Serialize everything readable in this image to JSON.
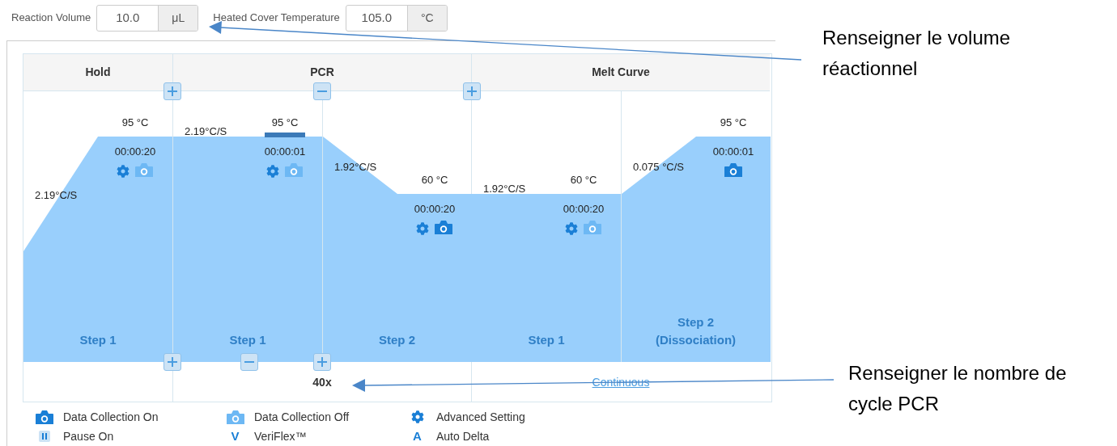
{
  "settings": [
    {
      "label": "Reaction Volume",
      "value": "10.0",
      "unit": "μL"
    },
    {
      "label": "Heated Cover Temperature",
      "value": "105.0",
      "unit": "°C"
    }
  ],
  "stages": [
    {
      "name": "Hold",
      "steps": [
        {
          "label": "Step 1",
          "temp": "95 °C",
          "time": "00:00:20",
          "rate": "2.19°C/S",
          "gear": true,
          "data_collection": false,
          "selected": false
        }
      ]
    },
    {
      "name": "PCR",
      "footer": {
        "kind": "cycles",
        "text": "40x"
      },
      "steps": [
        {
          "label": "Step 1",
          "temp": "95 °C",
          "time": "00:00:01",
          "rate": "2.19°C/S",
          "gear": true,
          "data_collection": false,
          "selected": true
        },
        {
          "label": "Step 2",
          "temp": "60 °C",
          "time": "00:00:20",
          "rate": "1.92°C/S",
          "gear": true,
          "data_collection": true,
          "selected": false
        }
      ]
    },
    {
      "name": "Melt Curve",
      "footer": {
        "kind": "link",
        "text": "Continuous"
      },
      "steps": [
        {
          "label": "Step 1",
          "temp": "60 °C",
          "time": "00:00:20",
          "rate": "1.92°C/S",
          "gear": true,
          "data_collection": false,
          "selected": false
        },
        {
          "label": "Step 2",
          "sublabel": "(Dissociation)",
          "temp": "95 °C",
          "time": "00:00:01",
          "rate": "0.075 °C/S",
          "gear": false,
          "data_collection": true,
          "selected": false
        }
      ]
    }
  ],
  "legend": [
    {
      "kind": "camera_on",
      "label": "Data Collection On"
    },
    {
      "kind": "camera_off",
      "label": "Data Collection Off"
    },
    {
      "kind": "gear",
      "label": "Advanced Setting"
    },
    {
      "kind": "pause",
      "label": "Pause On"
    },
    {
      "kind": "letter",
      "glyph": "V",
      "label": "VeriFlex™"
    },
    {
      "kind": "letter",
      "glyph": "A",
      "label": "Auto Delta"
    }
  ],
  "annotations": [
    {
      "text": "Renseigner le volume réactionnel"
    },
    {
      "text": "Renseigner le nombre de cycle PCR"
    }
  ]
}
